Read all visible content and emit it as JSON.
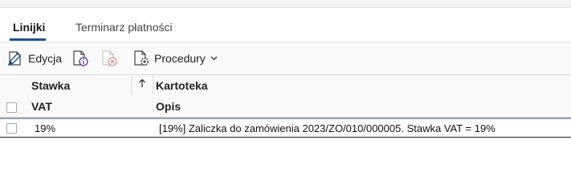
{
  "tabs": [
    {
      "label": "Linijki",
      "active": true
    },
    {
      "label": "Terminarz płatności",
      "active": false
    }
  ],
  "toolbar": {
    "edit_label": "Edycja",
    "info_icon": "document-info-icon",
    "delete_icon": "document-delete-icon",
    "procedures_label": "Procedury",
    "procedures_chevron": "chevron-down-icon"
  },
  "grid": {
    "columns": {
      "stawka": "Stawka",
      "vat": "VAT",
      "kartoteka": "Kartoteka",
      "opis": "Opis"
    },
    "sort_icon": "arrow-up-icon",
    "rows": [
      {
        "vat": "19%",
        "opis": "[19%] Zaliczka do zamówienia 2023/ZO/010/000005. Stawka VAT = 19%"
      }
    ]
  },
  "colors": {
    "accent": "#1f4e8c",
    "row_border": "#9aa4b2",
    "icon_purple": "#6a3ea1",
    "icon_disabled": "#c8c8c8",
    "icon_delete": "#e08a8a"
  }
}
